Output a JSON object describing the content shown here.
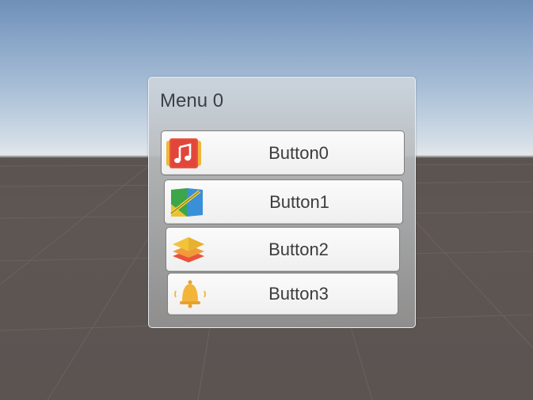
{
  "menu": {
    "title": "Menu 0",
    "buttons": [
      {
        "label": "Button0",
        "icon": "music-note-icon"
      },
      {
        "label": "Button1",
        "icon": "map-icon"
      },
      {
        "label": "Button2",
        "icon": "layers-icon"
      },
      {
        "label": "Button3",
        "icon": "bell-icon"
      }
    ]
  },
  "colors": {
    "sky_top": "#6f8fb8",
    "horizon": "#e3e7ea",
    "ground": "#5c5451",
    "panel": "#b9bcbe",
    "button": "#f5f5f5",
    "text": "#3c3c3c"
  }
}
